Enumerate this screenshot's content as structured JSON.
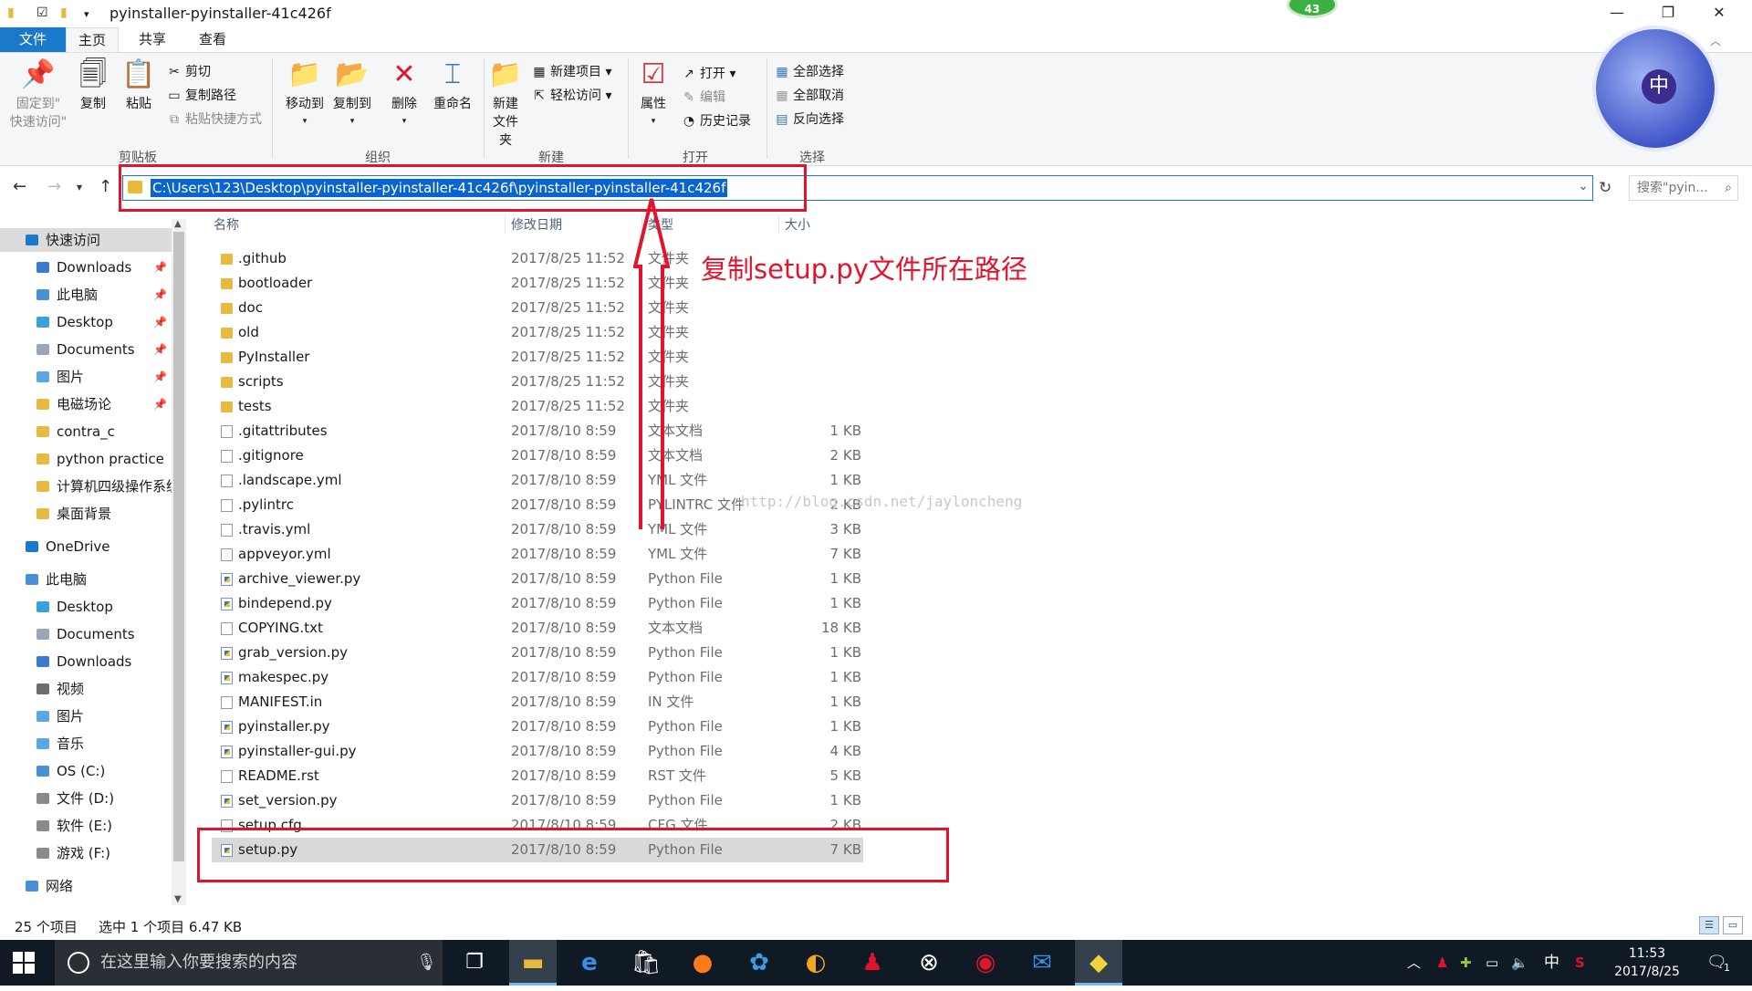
{
  "window": {
    "title": "pyinstaller-pyinstaller-41c426f",
    "notification_badge": "43"
  },
  "tabs": [
    "文件",
    "主页",
    "共享",
    "查看"
  ],
  "ribbon": {
    "clipboard": {
      "pin": "固定到\"\n快速访问\"",
      "pin_l1": "固定到\"",
      "pin_l2": "快速访问\"",
      "copy": "复制",
      "paste": "粘贴",
      "cut": "剪切",
      "copy_path": "复制路径",
      "paste_shortcut": "粘贴快捷方式",
      "group": "剪贴板"
    },
    "organize": {
      "move_to": "移动到",
      "copy_to": "复制到",
      "delete": "删除",
      "rename": "重命名",
      "group": "组织"
    },
    "new": {
      "new_folder_l1": "新建",
      "new_folder_l2": "文件夹",
      "new_item": "新建项目",
      "easy_access": "轻松访问",
      "group": "新建"
    },
    "open": {
      "properties": "属性",
      "open": "打开",
      "edit": "编辑",
      "history": "历史记录",
      "group": "打开"
    },
    "select": {
      "select_all": "全部选择",
      "select_none": "全部取消",
      "invert": "反向选择",
      "group": "选择"
    }
  },
  "avatar_char": "中",
  "address": {
    "path": "C:\\Users\\123\\Desktop\\pyinstaller-pyinstaller-41c426f\\pyinstaller-pyinstaller-41c426f",
    "search_placeholder": "搜索\"pyin..."
  },
  "nav": [
    {
      "label": "快速访问",
      "color": "#1979ca",
      "pinned": false,
      "indent": 0,
      "selected": true
    },
    {
      "label": "Downloads",
      "color": "#3b7ad1",
      "pinned": true,
      "indent": 1
    },
    {
      "label": "此电脑",
      "color": "#4a90d9",
      "pinned": true,
      "indent": 1
    },
    {
      "label": "Desktop",
      "color": "#3aa0e0",
      "pinned": true,
      "indent": 1
    },
    {
      "label": "Documents",
      "color": "#9aa6b8",
      "pinned": true,
      "indent": 1
    },
    {
      "label": "图片",
      "color": "#58a8e8",
      "pinned": true,
      "indent": 1
    },
    {
      "label": "电磁场论",
      "color": "#e8b93f",
      "pinned": true,
      "indent": 1
    },
    {
      "label": "contra_c",
      "color": "#e8b93f",
      "pinned": false,
      "indent": 1
    },
    {
      "label": "python practice",
      "color": "#e8b93f",
      "pinned": false,
      "indent": 1
    },
    {
      "label": "计算机四级操作系统",
      "color": "#e8b93f",
      "pinned": false,
      "indent": 1
    },
    {
      "label": "桌面背景",
      "color": "#e8b93f",
      "pinned": false,
      "indent": 1
    },
    {
      "label": "OneDrive",
      "color": "#1979ca",
      "pinned": false,
      "indent": 0,
      "gap": true
    },
    {
      "label": "此电脑",
      "color": "#4a90d9",
      "pinned": false,
      "indent": 0,
      "gap": true
    },
    {
      "label": "Desktop",
      "color": "#3aa0e0",
      "pinned": false,
      "indent": 1
    },
    {
      "label": "Documents",
      "color": "#9aa6b8",
      "pinned": false,
      "indent": 1
    },
    {
      "label": "Downloads",
      "color": "#3b7ad1",
      "pinned": false,
      "indent": 1
    },
    {
      "label": "视频",
      "color": "#6d6d6d",
      "pinned": false,
      "indent": 1
    },
    {
      "label": "图片",
      "color": "#58a8e8",
      "pinned": false,
      "indent": 1
    },
    {
      "label": "音乐",
      "color": "#58a8e8",
      "pinned": false,
      "indent": 1
    },
    {
      "label": "OS (C:)",
      "color": "#4a90d9",
      "pinned": false,
      "indent": 1
    },
    {
      "label": "文件 (D:)",
      "color": "#8a8a8a",
      "pinned": false,
      "indent": 1
    },
    {
      "label": "软件 (E:)",
      "color": "#8a8a8a",
      "pinned": false,
      "indent": 1
    },
    {
      "label": "游戏 (F:)",
      "color": "#8a8a8a",
      "pinned": false,
      "indent": 1
    },
    {
      "label": "网络",
      "color": "#4a90d9",
      "pinned": false,
      "indent": 0,
      "gap": true
    }
  ],
  "columns": {
    "name": "名称",
    "date": "修改日期",
    "type": "类型",
    "size": "大小"
  },
  "files": [
    {
      "name": ".github",
      "date": "2017/8/25 11:52",
      "type": "文件夹",
      "size": "",
      "kind": "folder"
    },
    {
      "name": "bootloader",
      "date": "2017/8/25 11:52",
      "type": "文件夹",
      "size": "",
      "kind": "folder"
    },
    {
      "name": "doc",
      "date": "2017/8/25 11:52",
      "type": "文件夹",
      "size": "",
      "kind": "folder"
    },
    {
      "name": "old",
      "date": "2017/8/25 11:52",
      "type": "文件夹",
      "size": "",
      "kind": "folder"
    },
    {
      "name": "PyInstaller",
      "date": "2017/8/25 11:52",
      "type": "文件夹",
      "size": "",
      "kind": "folder"
    },
    {
      "name": "scripts",
      "date": "2017/8/25 11:52",
      "type": "文件夹",
      "size": "",
      "kind": "folder"
    },
    {
      "name": "tests",
      "date": "2017/8/25 11:52",
      "type": "文件夹",
      "size": "",
      "kind": "folder"
    },
    {
      "name": ".gitattributes",
      "date": "2017/8/10 8:59",
      "type": "文本文档",
      "size": "1 KB",
      "kind": "file"
    },
    {
      "name": ".gitignore",
      "date": "2017/8/10 8:59",
      "type": "文本文档",
      "size": "2 KB",
      "kind": "file"
    },
    {
      "name": ".landscape.yml",
      "date": "2017/8/10 8:59",
      "type": "YML 文件",
      "size": "1 KB",
      "kind": "file"
    },
    {
      "name": ".pylintrc",
      "date": "2017/8/10 8:59",
      "type": "PYLINTRC 文件",
      "size": "2 KB",
      "kind": "file"
    },
    {
      "name": ".travis.yml",
      "date": "2017/8/10 8:59",
      "type": "YML 文件",
      "size": "3 KB",
      "kind": "file"
    },
    {
      "name": "appveyor.yml",
      "date": "2017/8/10 8:59",
      "type": "YML 文件",
      "size": "7 KB",
      "kind": "file"
    },
    {
      "name": "archive_viewer.py",
      "date": "2017/8/10 8:59",
      "type": "Python File",
      "size": "1 KB",
      "kind": "py"
    },
    {
      "name": "bindepend.py",
      "date": "2017/8/10 8:59",
      "type": "Python File",
      "size": "1 KB",
      "kind": "py"
    },
    {
      "name": "COPYING.txt",
      "date": "2017/8/10 8:59",
      "type": "文本文档",
      "size": "18 KB",
      "kind": "file"
    },
    {
      "name": "grab_version.py",
      "date": "2017/8/10 8:59",
      "type": "Python File",
      "size": "1 KB",
      "kind": "py"
    },
    {
      "name": "makespec.py",
      "date": "2017/8/10 8:59",
      "type": "Python File",
      "size": "1 KB",
      "kind": "py"
    },
    {
      "name": "MANIFEST.in",
      "date": "2017/8/10 8:59",
      "type": "IN 文件",
      "size": "1 KB",
      "kind": "file"
    },
    {
      "name": "pyinstaller.py",
      "date": "2017/8/10 8:59",
      "type": "Python File",
      "size": "1 KB",
      "kind": "py"
    },
    {
      "name": "pyinstaller-gui.py",
      "date": "2017/8/10 8:59",
      "type": "Python File",
      "size": "4 KB",
      "kind": "py"
    },
    {
      "name": "README.rst",
      "date": "2017/8/10 8:59",
      "type": "RST 文件",
      "size": "5 KB",
      "kind": "file"
    },
    {
      "name": "set_version.py",
      "date": "2017/8/10 8:59",
      "type": "Python File",
      "size": "1 KB",
      "kind": "py"
    },
    {
      "name": "setup.cfg",
      "date": "2017/8/10 8:59",
      "type": "CFG 文件",
      "size": "2 KB",
      "kind": "file"
    },
    {
      "name": "setup.py",
      "date": "2017/8/10 8:59",
      "type": "Python File",
      "size": "7 KB",
      "kind": "py",
      "selected": true
    }
  ],
  "annotation": "复制setup.py文件所在路径",
  "watermark": "http://blog.csdn.net/jayloncheng",
  "status": {
    "count": "25 个项目",
    "selection": "选中 1 个项目  6.47 KB"
  },
  "taskbar": {
    "search_placeholder": "在这里输入你要搜索的内容",
    "ime": "中",
    "time": "11:53",
    "date": "2017/8/25",
    "notif_count": "1"
  }
}
